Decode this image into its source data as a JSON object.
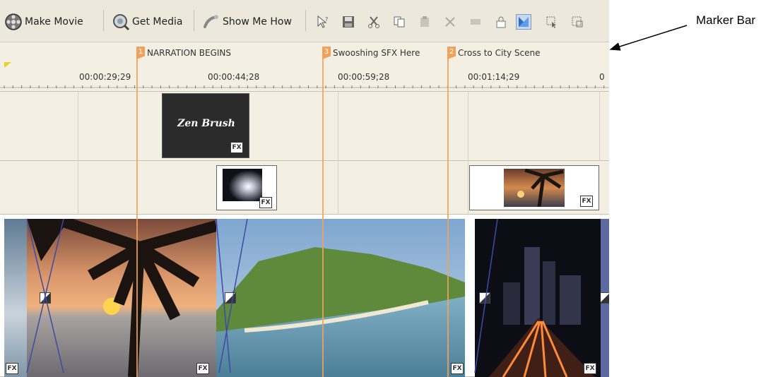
{
  "toolbar": {
    "make_movie": "Make Movie",
    "get_media": "Get Media",
    "show_me_how": "Show Me How",
    "icons": [
      "help-pointer-icon",
      "save-icon",
      "cut-icon",
      "copy-icon",
      "paste-icon",
      "delete-icon",
      "clear-icon",
      "lock-icon",
      "split-icon",
      "select-icon",
      "crop-icon"
    ]
  },
  "markers": [
    {
      "number": "1",
      "label": "NARRATION BEGINS"
    },
    {
      "number": "3",
      "label": "Swooshing SFX Here"
    },
    {
      "number": "2",
      "label": "Cross to City Scene"
    }
  ],
  "ruler": {
    "timecodes": [
      "00:00:29;29",
      "00:00:44;28",
      "00:00:59;28",
      "00:01:14;29",
      "0"
    ]
  },
  "title_clip": {
    "text": "Zen Brush",
    "fx": "FX"
  },
  "clips_fx": "FX",
  "annotation": {
    "label": "Marker Bar"
  },
  "colors": {
    "marker": "#f0a25b",
    "panel": "#f3efe3",
    "toolbar": "#ece8db"
  }
}
